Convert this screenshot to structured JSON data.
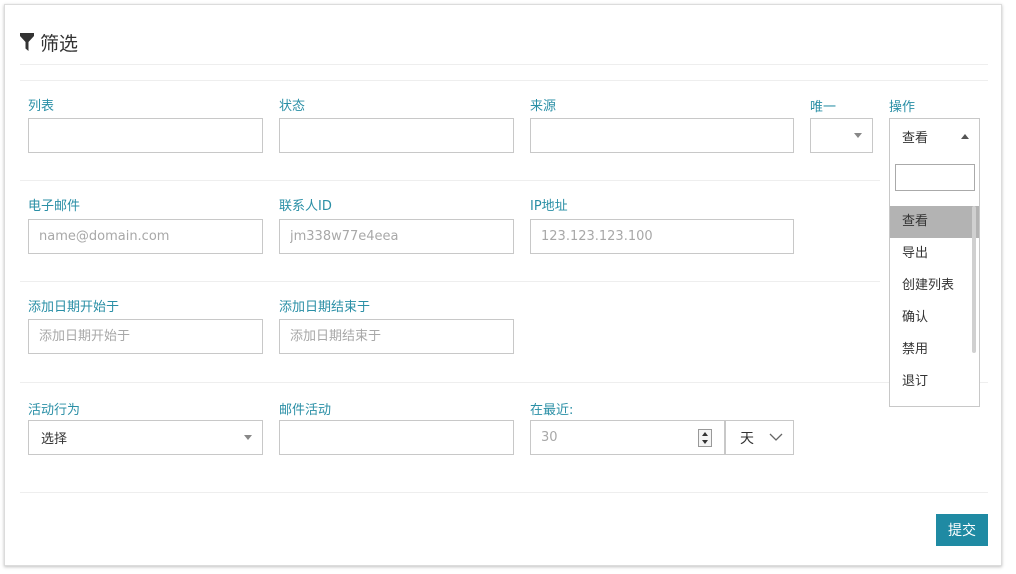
{
  "header": {
    "title": "筛选"
  },
  "row1": {
    "list_label": "列表",
    "status_label": "状态",
    "source_label": "来源",
    "unique_label": "唯一",
    "action_label": "操作",
    "action_selected": "查看"
  },
  "row2": {
    "email_label": "电子邮件",
    "email_placeholder": "name@domain.com",
    "contact_id_label": "联系人ID",
    "contact_id_placeholder": "jm338w77e4eea",
    "ip_label": "IP地址",
    "ip_placeholder": "123.123.123.100"
  },
  "row3": {
    "date_start_label": "添加日期开始于",
    "date_start_placeholder": "添加日期开始于",
    "date_end_label": "添加日期结束于",
    "date_end_placeholder": "添加日期结束于"
  },
  "row4": {
    "activity_label": "活动行为",
    "activity_selected": "选择",
    "mail_activity_label": "邮件活动",
    "recent_label": "在最近:",
    "recent_value": "30",
    "recent_unit": "天"
  },
  "dropdown": {
    "options": [
      "查看",
      "导出",
      "创建列表",
      "确认",
      "禁用",
      "退订"
    ]
  },
  "footer": {
    "submit_label": "提交"
  },
  "colors": {
    "accent": "#1f8aa3",
    "label": "#2a8fa6"
  }
}
